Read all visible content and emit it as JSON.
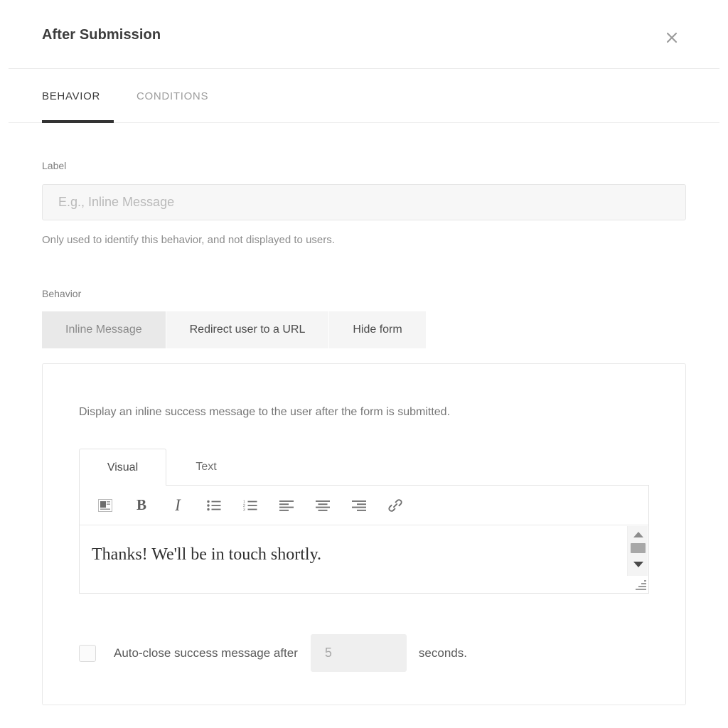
{
  "header": {
    "title": "After Submission",
    "close_icon": "close-icon"
  },
  "tabs": [
    {
      "label": "BEHAVIOR",
      "active": true
    },
    {
      "label": "CONDITIONS",
      "active": false
    }
  ],
  "form": {
    "label_caption": "Label",
    "label_placeholder": "E.g., Inline Message",
    "label_value": "",
    "label_help": "Only used to identify this behavior, and not displayed to users.",
    "behavior_caption": "Behavior",
    "behavior_options": [
      {
        "label": "Inline Message",
        "selected": true
      },
      {
        "label": "Redirect user to a URL",
        "selected": false
      },
      {
        "label": "Hide form",
        "selected": false
      }
    ]
  },
  "card": {
    "description": "Display an inline success message to the user after the form is submitted.",
    "editor": {
      "tabs": [
        {
          "label": "Visual",
          "active": true
        },
        {
          "label": "Text",
          "active": false
        }
      ],
      "toolbar": [
        {
          "name": "paragraph-block-icon",
          "title": "Paragraph block"
        },
        {
          "name": "bold-icon",
          "glyph": "B",
          "title": "Bold"
        },
        {
          "name": "italic-icon",
          "glyph": "I",
          "title": "Italic"
        },
        {
          "name": "bulleted-list-icon",
          "title": "Bulleted list"
        },
        {
          "name": "numbered-list-icon",
          "title": "Numbered list"
        },
        {
          "name": "align-left-icon",
          "title": "Align left"
        },
        {
          "name": "align-center-icon",
          "title": "Align center"
        },
        {
          "name": "align-right-icon",
          "title": "Align right"
        },
        {
          "name": "link-icon",
          "title": "Insert link"
        }
      ],
      "content": "Thanks! We'll be in touch shortly."
    },
    "autoclose": {
      "checked": false,
      "label": "Auto-close success message after",
      "seconds_value": "5",
      "suffix": "seconds."
    }
  },
  "colors": {
    "text_dark": "#3c3c3c",
    "text_muted": "#8d8d8d",
    "accent_underline": "#333333",
    "segment_selected_bg": "#e9e9e9",
    "segment_bg": "#f5f5f5",
    "border": "#e8e8e8"
  }
}
